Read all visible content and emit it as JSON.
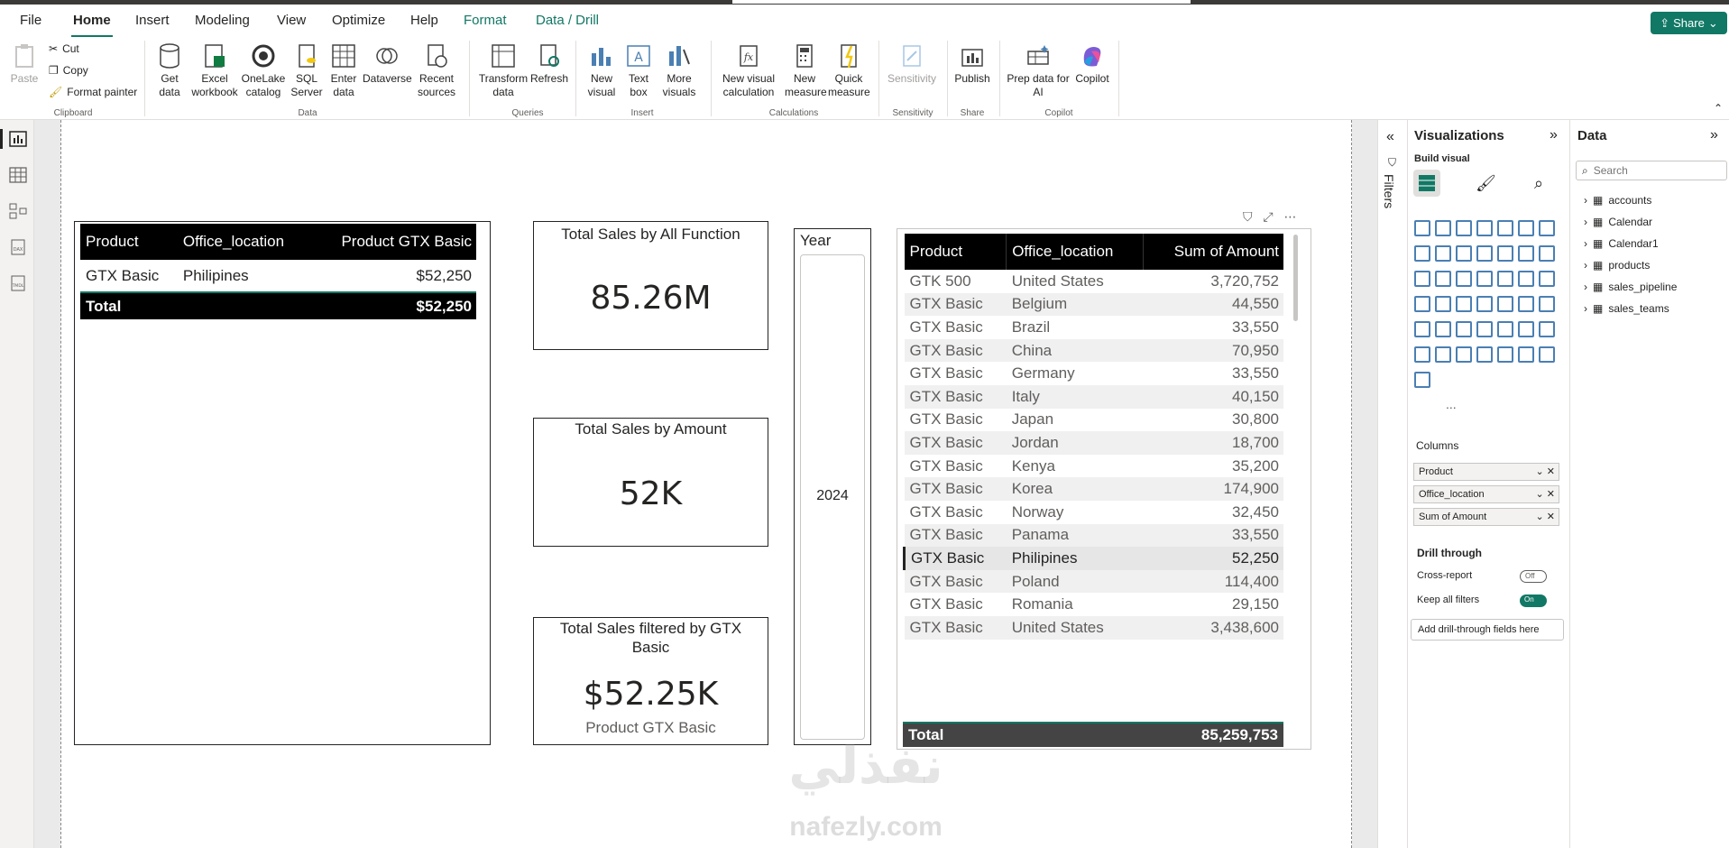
{
  "menu": {
    "tabs": [
      "File",
      "Home",
      "Insert",
      "Modeling",
      "View",
      "Optimize",
      "Help",
      "Format",
      "Data / Drill"
    ],
    "share": "Share"
  },
  "ribbon": {
    "clipboard": {
      "paste": "Paste",
      "cut": "Cut",
      "copy": "Copy",
      "format_painter": "Format painter",
      "group": "Clipboard"
    },
    "data": {
      "get_data": "Get data",
      "excel": "Excel workbook",
      "onelake": "OneLake catalog",
      "sql": "SQL Server",
      "enter": "Enter data",
      "dataverse": "Dataverse",
      "recent": "Recent sources",
      "group": "Data"
    },
    "queries": {
      "transform": "Transform data",
      "refresh": "Refresh",
      "group": "Queries"
    },
    "insert": {
      "new_visual": "New visual",
      "text_box": "Text box",
      "more_visuals": "More visuals",
      "group": "Insert"
    },
    "calculations": {
      "new_visual_calc": "New visual calculation",
      "new_measure": "New measure",
      "quick_measure": "Quick measure",
      "group": "Calculations"
    },
    "sensitivity": {
      "label": "Sensitivity",
      "group": "Sensitivity"
    },
    "share": {
      "publish": "Publish",
      "group": "Share"
    },
    "copilot": {
      "prep": "Prep data for AI",
      "copilot": "Copilot",
      "group": "Copilot"
    }
  },
  "table1": {
    "headers": [
      "Product",
      "Office_location",
      "Product GTX Basic"
    ],
    "rows": [
      [
        "GTX Basic",
        "Philipines",
        "$52,250"
      ]
    ],
    "total": [
      "Total",
      "",
      "$52,250"
    ]
  },
  "card1": {
    "title": "Total Sales by All Function",
    "value": "85.26M"
  },
  "card2": {
    "title": "Total Sales by Amount",
    "value": "52K"
  },
  "card3": {
    "title": "Total Sales filtered by GTX Basic",
    "value": "$52.25K",
    "subtitle": "Product GTX Basic"
  },
  "slicer": {
    "title": "Year",
    "value": "2024"
  },
  "table2": {
    "headers": [
      "Product",
      "Office_location",
      "Sum of Amount"
    ],
    "rows": [
      [
        "GTK 500",
        "United States",
        "3,720,752"
      ],
      [
        "GTX Basic",
        "Belgium",
        "44,550"
      ],
      [
        "GTX Basic",
        "Brazil",
        "33,550"
      ],
      [
        "GTX Basic",
        "China",
        "70,950"
      ],
      [
        "GTX Basic",
        "Germany",
        "33,550"
      ],
      [
        "GTX Basic",
        "Italy",
        "40,150"
      ],
      [
        "GTX Basic",
        "Japan",
        "30,800"
      ],
      [
        "GTX Basic",
        "Jordan",
        "18,700"
      ],
      [
        "GTX Basic",
        "Kenya",
        "35,200"
      ],
      [
        "GTX Basic",
        "Korea",
        "174,900"
      ],
      [
        "GTX Basic",
        "Norway",
        "32,450"
      ],
      [
        "GTX Basic",
        "Panama",
        "33,550"
      ],
      [
        "GTX Basic",
        "Philipines",
        "52,250"
      ],
      [
        "GTX Basic",
        "Poland",
        "114,400"
      ],
      [
        "GTX Basic",
        "Romania",
        "29,150"
      ],
      [
        "GTX Basic",
        "United States",
        "3,438,600"
      ]
    ],
    "total": [
      "Total",
      "",
      "85,259,753"
    ]
  },
  "filters_label": "Filters",
  "viz": {
    "title": "Visualizations",
    "build": "Build visual",
    "columns_label": "Columns",
    "fields": [
      "Product",
      "Office_location",
      "Sum of Amount"
    ],
    "drill_through": "Drill through",
    "cross_report": "Cross-report",
    "cross_state": "Off",
    "keep_filters": "Keep all filters",
    "keep_state": "On",
    "add_drill": "Add drill-through fields here",
    "more": "..."
  },
  "data_pane": {
    "title": "Data",
    "search_placeholder": "Search",
    "tables": [
      "accounts",
      "Calendar",
      "Calendar1",
      "products",
      "sales_pipeline",
      "sales_teams"
    ]
  },
  "watermark": {
    "arabic": "نفذلي",
    "latin": "nafezly.com"
  }
}
